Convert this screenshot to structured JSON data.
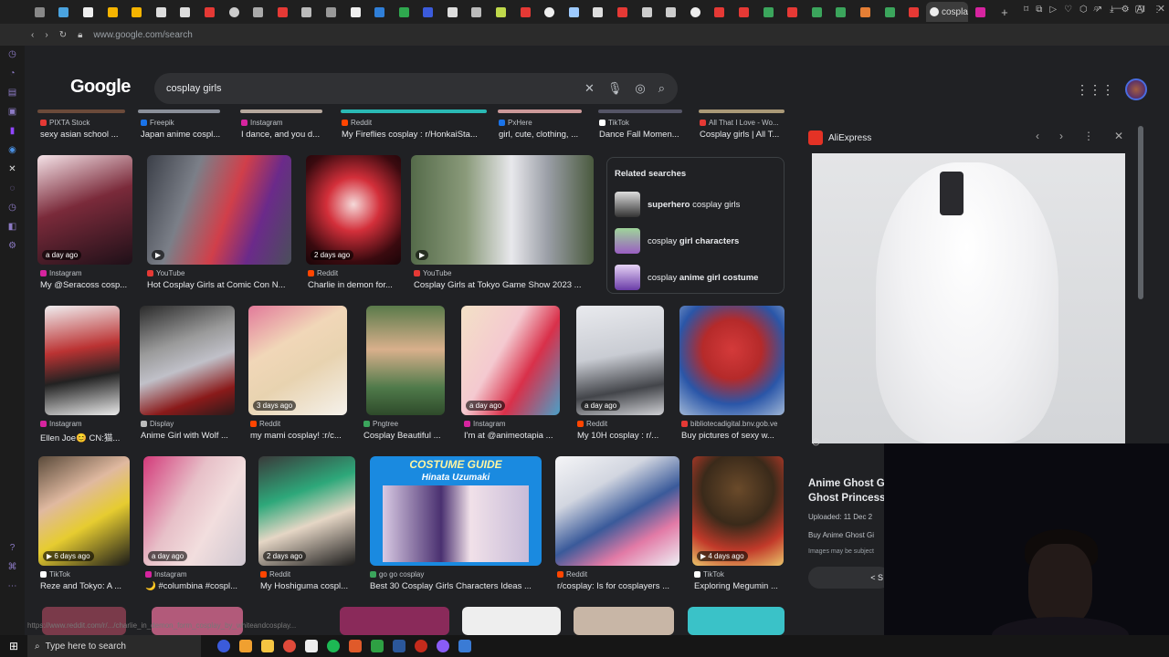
{
  "browser": {
    "active_tab_label": "cosplа",
    "url": "www.google.com/search",
    "right_label": "AI"
  },
  "google": {
    "logo": "Google",
    "query": "cosplay girls",
    "icons": [
      "clear-icon",
      "mic-icon",
      "lens-icon",
      "search-icon"
    ]
  },
  "row1": [
    {
      "source": "PIXTA Stock",
      "title": "sexy asian school ..."
    },
    {
      "source": "Freepik",
      "title": "Japan anime cospl..."
    },
    {
      "source": "Instagram",
      "title": "I dance, and you d..."
    },
    {
      "source": "Reddit",
      "title": "My Fireflies cosplay : r/HonkaiSta..."
    },
    {
      "source": "PxHere",
      "title": "girl, cute, clothing, ..."
    },
    {
      "source": "TikTok",
      "title": "Dance Fall Momen..."
    },
    {
      "source": "All That I Love - Wo...",
      "title": "Cosplay girls | All T..."
    }
  ],
  "row2": [
    {
      "source": "Instagram",
      "title": "My @Seracoss cosp...",
      "ago": "a day ago"
    },
    {
      "source": "YouTube",
      "title": "Hot Cosplay Girls at Comic Con N...",
      "ago": ""
    },
    {
      "source": "Reddit",
      "title": "Charlie in demon for...",
      "ago": "2 days ago"
    },
    {
      "source": "YouTube",
      "title": "Cosplay Girls at Tokyo Game Show 2023 ...",
      "ago": ""
    }
  ],
  "related": {
    "heading": "Related searches",
    "items": [
      {
        "bold": "superhero",
        "rest": " cosplay girls"
      },
      {
        "pre": "cosplay ",
        "bold": "girl characters"
      },
      {
        "pre": "cosplay ",
        "bold": "anime girl costume"
      }
    ]
  },
  "row3": [
    {
      "source": "Instagram",
      "title": "Ellen Joe😊 CN:猫...",
      "ago": ""
    },
    {
      "source": "Display",
      "title": "Anime Girl with Wolf ...",
      "ago": ""
    },
    {
      "source": "Reddit",
      "title": "my mami cosplay! :r/c...",
      "ago": "3 days ago"
    },
    {
      "source": "Pngtree",
      "title": "Cosplay Beautiful ...",
      "ago": ""
    },
    {
      "source": "Instagram",
      "title": "I'm at @animeotapia ...",
      "ago": "a day ago"
    },
    {
      "source": "Reddit",
      "title": "My 10H cosplay : r/...",
      "ago": "a day ago"
    },
    {
      "source": "bibliotecadigital.bnv.gob.ve",
      "title": "Buy pictures of sexy w...",
      "ago": ""
    }
  ],
  "row4": [
    {
      "source": "TikTok",
      "title": "Reze and Tokyo: A ...",
      "ago": "6 days ago"
    },
    {
      "source": "Instagram",
      "title": "🌙 #columbina #cospl...",
      "ago": "a day ago"
    },
    {
      "source": "Reddit",
      "title": "My Hoshiguma cospl...",
      "ago": "2 days ago"
    },
    {
      "source": "go go cosplay",
      "title": "Best 30 Cosplay Girls Characters Ideas ...",
      "ago": "",
      "banner": "COSTUME GUIDE",
      "banner_sub": "Hinata Uzumaki"
    },
    {
      "source": "Reddit",
      "title": "r/cosplay: Is for cosplayers ...",
      "ago": ""
    },
    {
      "source": "TikTok",
      "title": "Exploring Megumin ...",
      "ago": "4 days ago"
    }
  ],
  "panel": {
    "site": "AliExpress",
    "title1": "Anime Ghost Gi",
    "title2": "Ghost Princess",
    "uploaded": "Uploaded: 11 Dec 2",
    "buy": "Buy Anime Ghost Gi",
    "copyright": "Images may be subject",
    "share": "S"
  },
  "status_url": "https://www.reddit.com/r/.../charlie_in_demon_form_cosplay_by_whiteandcosplay...",
  "taskbar": {
    "search_placeholder": "Type here to search"
  },
  "colors": {
    "bg": "#202124",
    "search_bg": "#303134",
    "aliexpress": "#e43225"
  }
}
